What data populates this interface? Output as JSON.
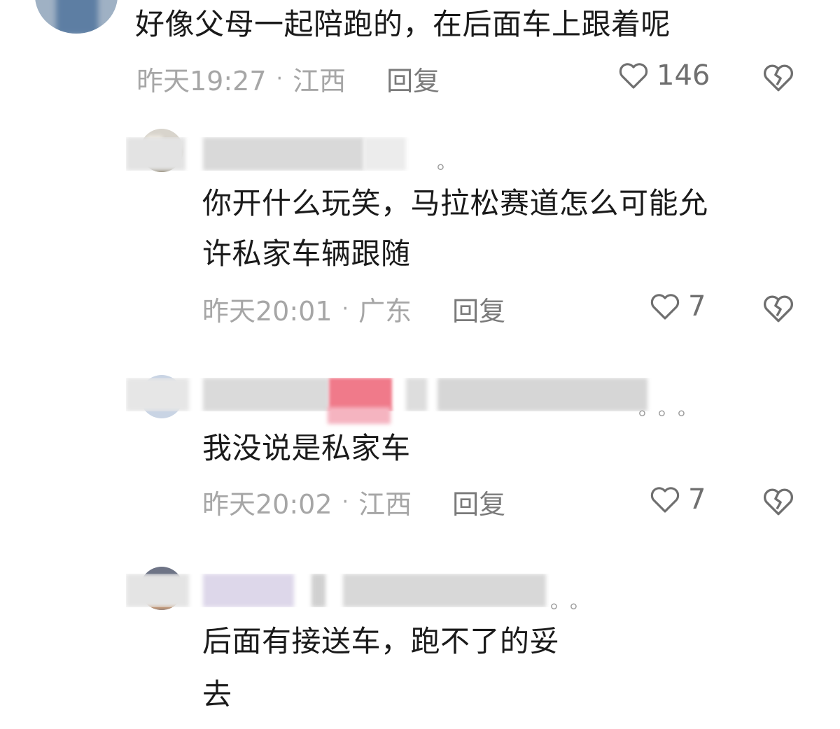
{
  "comments": [
    {
      "text_lines": [
        "好像父母一起陪跑的，在后面车上跟着呢"
      ],
      "time": "昨天19:27",
      "separator": "·",
      "location": "江西",
      "reply_label": "回复",
      "likes": "146"
    },
    {
      "text_lines": [
        "你开什么玩笑，马拉松赛道怎么可能允",
        "许私家车辆跟随"
      ],
      "time": "昨天20:01",
      "separator": "·",
      "location": "广东",
      "reply_label": "回复",
      "likes": "7"
    },
    {
      "text_lines": [
        "我没说是私家车"
      ],
      "time": "昨天20:02",
      "separator": "·",
      "location": "江西",
      "reply_label": "回复",
      "likes": "7"
    },
    {
      "text_lines": [
        "后面有接送车，跑不了的妥",
        "去"
      ]
    }
  ],
  "icons": {
    "like": "heart-outline-icon",
    "dislike": "broken-heart-icon"
  },
  "colors": {
    "text": "#1a1a1a",
    "meta": "#a6a6a6",
    "reply": "#7a7a7a",
    "icon": "#6f6f6f"
  }
}
